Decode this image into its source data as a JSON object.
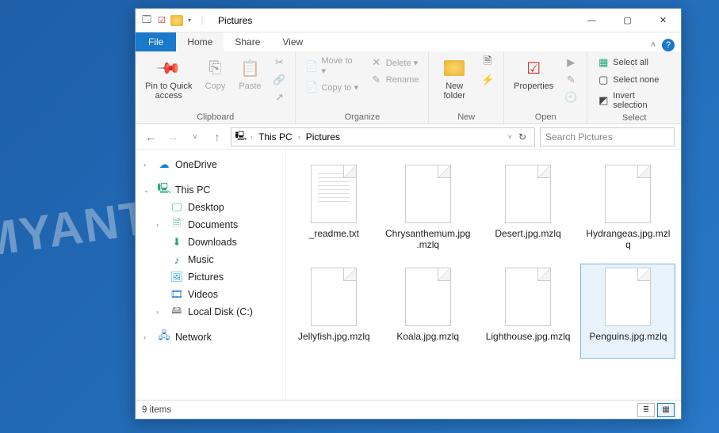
{
  "window": {
    "title": "Pictures",
    "controls": {
      "min": "—",
      "max": "▢",
      "close": "✕"
    }
  },
  "tabs": {
    "file": "File",
    "items": [
      "Home",
      "Share",
      "View"
    ],
    "active": "Home",
    "collapse_glyph": "˄",
    "help_glyph": "?"
  },
  "ribbon": {
    "clipboard": {
      "label": "Clipboard",
      "pin": "Pin to Quick access",
      "copy": "Copy",
      "paste": "Paste",
      "cut_glyph": "✂"
    },
    "organize": {
      "label": "Organize",
      "moveto": "Move to ▾",
      "copyto": "Copy to ▾",
      "delete": "Delete ▾",
      "rename": "Rename"
    },
    "new": {
      "label": "New",
      "newfolder": "New folder"
    },
    "open": {
      "label": "Open",
      "properties": "Properties"
    },
    "select": {
      "label": "Select",
      "all": "Select all",
      "none": "Select none",
      "invert": "Invert selection"
    }
  },
  "address": {
    "back": "←",
    "fwd": "→",
    "recent": "˅",
    "up": "↑",
    "crumbs": [
      "This PC",
      "Pictures"
    ],
    "refresh": "↻",
    "search_placeholder": "Search Pictures"
  },
  "nav": {
    "onedrive": "OneDrive",
    "thispc": "This PC",
    "desktop": "Desktop",
    "documents": "Documents",
    "downloads": "Downloads",
    "music": "Music",
    "pictures": "Pictures",
    "videos": "Videos",
    "localdisk": "Local Disk (C:)",
    "network": "Network"
  },
  "files": [
    {
      "name": "_readme.txt",
      "type": "txt",
      "selected": false
    },
    {
      "name": "Chrysanthemum.jpg.mzlq",
      "type": "blank",
      "selected": false
    },
    {
      "name": "Desert.jpg.mzlq",
      "type": "blank",
      "selected": false
    },
    {
      "name": "Hydrangeas.jpg.mzlq",
      "type": "blank",
      "selected": false
    },
    {
      "name": "Jellyfish.jpg.mzlq",
      "type": "blank",
      "selected": false
    },
    {
      "name": "Koala.jpg.mzlq",
      "type": "blank",
      "selected": false
    },
    {
      "name": "Lighthouse.jpg.mzlq",
      "type": "blank",
      "selected": false
    },
    {
      "name": "Penguins.jpg.mzlq",
      "type": "blank",
      "selected": true
    }
  ],
  "status": {
    "count": "9 items"
  },
  "watermark": "MYANTISPYWARE.COM"
}
